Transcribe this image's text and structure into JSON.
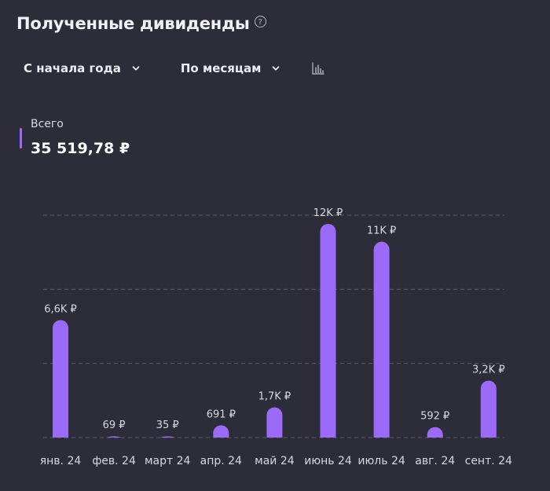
{
  "header": {
    "title": "Полученные дивиденды",
    "help_icon": "?"
  },
  "filters": {
    "period": "С начала года",
    "grouping": "По месяцам",
    "chart_type_icon": "bar-chart-icon"
  },
  "summary": {
    "label": "Всего",
    "value": "35 519,78 ₽"
  },
  "colors": {
    "background": "#2d2d39",
    "bar": "#9b6af7",
    "grid": "#5a5a66",
    "text": "#d8d8df"
  },
  "chart_data": {
    "type": "bar",
    "categories": [
      "янв. 24",
      "фев. 24",
      "март 24",
      "апр. 24",
      "май 24",
      "июнь 24",
      "июль 24",
      "авг. 24",
      "сент. 24"
    ],
    "values": [
      6600,
      69,
      35,
      691,
      1700,
      12000,
      11000,
      592,
      3200
    ],
    "data_labels": [
      "6,6K ₽",
      "69 ₽",
      "35 ₽",
      "691 ₽",
      "1,7K ₽",
      "12K ₽",
      "11K ₽",
      "592 ₽",
      "3,2K ₽"
    ],
    "ylim": [
      0,
      12000
    ],
    "grid": true,
    "legend": false
  }
}
